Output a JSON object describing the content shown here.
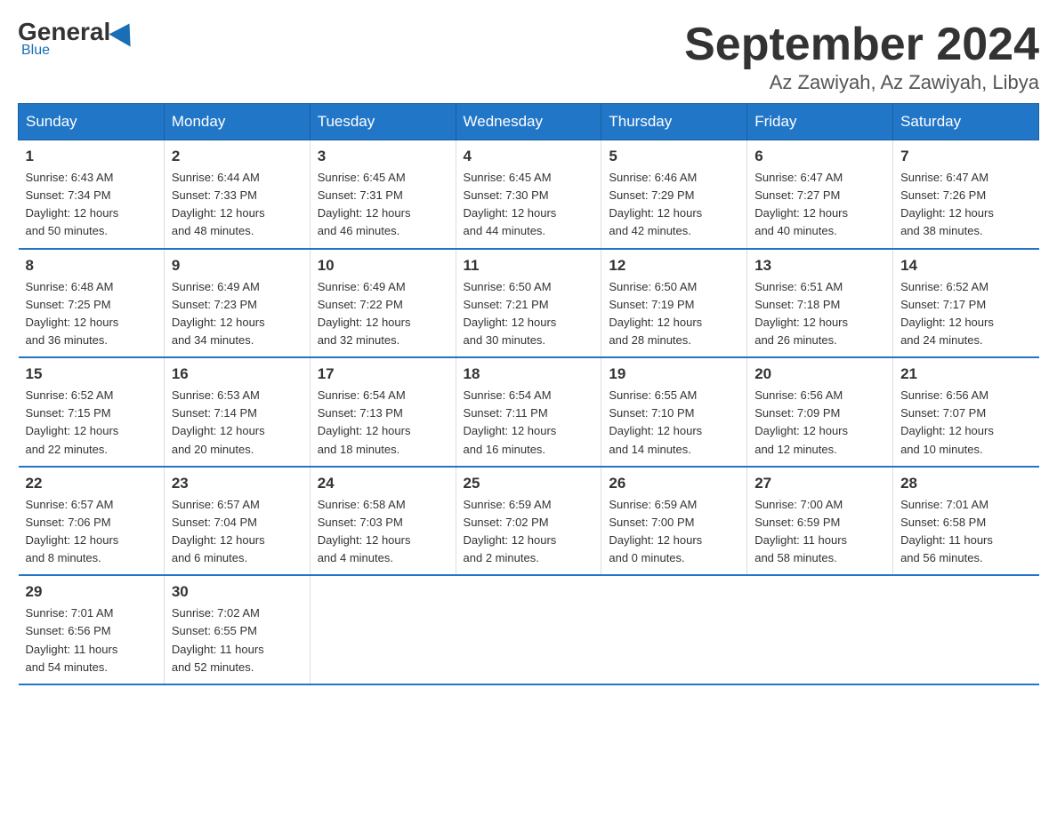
{
  "logo": {
    "general": "General",
    "blue": "Blue",
    "subtitle": "Blue"
  },
  "title": {
    "month": "September 2024",
    "location": "Az Zawiyah, Az Zawiyah, Libya"
  },
  "headers": [
    "Sunday",
    "Monday",
    "Tuesday",
    "Wednesday",
    "Thursday",
    "Friday",
    "Saturday"
  ],
  "weeks": [
    [
      {
        "day": "1",
        "sunrise": "6:43 AM",
        "sunset": "7:34 PM",
        "daylight": "12 hours and 50 minutes."
      },
      {
        "day": "2",
        "sunrise": "6:44 AM",
        "sunset": "7:33 PM",
        "daylight": "12 hours and 48 minutes."
      },
      {
        "day": "3",
        "sunrise": "6:45 AM",
        "sunset": "7:31 PM",
        "daylight": "12 hours and 46 minutes."
      },
      {
        "day": "4",
        "sunrise": "6:45 AM",
        "sunset": "7:30 PM",
        "daylight": "12 hours and 44 minutes."
      },
      {
        "day": "5",
        "sunrise": "6:46 AM",
        "sunset": "7:29 PM",
        "daylight": "12 hours and 42 minutes."
      },
      {
        "day": "6",
        "sunrise": "6:47 AM",
        "sunset": "7:27 PM",
        "daylight": "12 hours and 40 minutes."
      },
      {
        "day": "7",
        "sunrise": "6:47 AM",
        "sunset": "7:26 PM",
        "daylight": "12 hours and 38 minutes."
      }
    ],
    [
      {
        "day": "8",
        "sunrise": "6:48 AM",
        "sunset": "7:25 PM",
        "daylight": "12 hours and 36 minutes."
      },
      {
        "day": "9",
        "sunrise": "6:49 AM",
        "sunset": "7:23 PM",
        "daylight": "12 hours and 34 minutes."
      },
      {
        "day": "10",
        "sunrise": "6:49 AM",
        "sunset": "7:22 PM",
        "daylight": "12 hours and 32 minutes."
      },
      {
        "day": "11",
        "sunrise": "6:50 AM",
        "sunset": "7:21 PM",
        "daylight": "12 hours and 30 minutes."
      },
      {
        "day": "12",
        "sunrise": "6:50 AM",
        "sunset": "7:19 PM",
        "daylight": "12 hours and 28 minutes."
      },
      {
        "day": "13",
        "sunrise": "6:51 AM",
        "sunset": "7:18 PM",
        "daylight": "12 hours and 26 minutes."
      },
      {
        "day": "14",
        "sunrise": "6:52 AM",
        "sunset": "7:17 PM",
        "daylight": "12 hours and 24 minutes."
      }
    ],
    [
      {
        "day": "15",
        "sunrise": "6:52 AM",
        "sunset": "7:15 PM",
        "daylight": "12 hours and 22 minutes."
      },
      {
        "day": "16",
        "sunrise": "6:53 AM",
        "sunset": "7:14 PM",
        "daylight": "12 hours and 20 minutes."
      },
      {
        "day": "17",
        "sunrise": "6:54 AM",
        "sunset": "7:13 PM",
        "daylight": "12 hours and 18 minutes."
      },
      {
        "day": "18",
        "sunrise": "6:54 AM",
        "sunset": "7:11 PM",
        "daylight": "12 hours and 16 minutes."
      },
      {
        "day": "19",
        "sunrise": "6:55 AM",
        "sunset": "7:10 PM",
        "daylight": "12 hours and 14 minutes."
      },
      {
        "day": "20",
        "sunrise": "6:56 AM",
        "sunset": "7:09 PM",
        "daylight": "12 hours and 12 minutes."
      },
      {
        "day": "21",
        "sunrise": "6:56 AM",
        "sunset": "7:07 PM",
        "daylight": "12 hours and 10 minutes."
      }
    ],
    [
      {
        "day": "22",
        "sunrise": "6:57 AM",
        "sunset": "7:06 PM",
        "daylight": "12 hours and 8 minutes."
      },
      {
        "day": "23",
        "sunrise": "6:57 AM",
        "sunset": "7:04 PM",
        "daylight": "12 hours and 6 minutes."
      },
      {
        "day": "24",
        "sunrise": "6:58 AM",
        "sunset": "7:03 PM",
        "daylight": "12 hours and 4 minutes."
      },
      {
        "day": "25",
        "sunrise": "6:59 AM",
        "sunset": "7:02 PM",
        "daylight": "12 hours and 2 minutes."
      },
      {
        "day": "26",
        "sunrise": "6:59 AM",
        "sunset": "7:00 PM",
        "daylight": "12 hours and 0 minutes."
      },
      {
        "day": "27",
        "sunrise": "7:00 AM",
        "sunset": "6:59 PM",
        "daylight": "11 hours and 58 minutes."
      },
      {
        "day": "28",
        "sunrise": "7:01 AM",
        "sunset": "6:58 PM",
        "daylight": "11 hours and 56 minutes."
      }
    ],
    [
      {
        "day": "29",
        "sunrise": "7:01 AM",
        "sunset": "6:56 PM",
        "daylight": "11 hours and 54 minutes."
      },
      {
        "day": "30",
        "sunrise": "7:02 AM",
        "sunset": "6:55 PM",
        "daylight": "11 hours and 52 minutes."
      },
      null,
      null,
      null,
      null,
      null
    ]
  ]
}
